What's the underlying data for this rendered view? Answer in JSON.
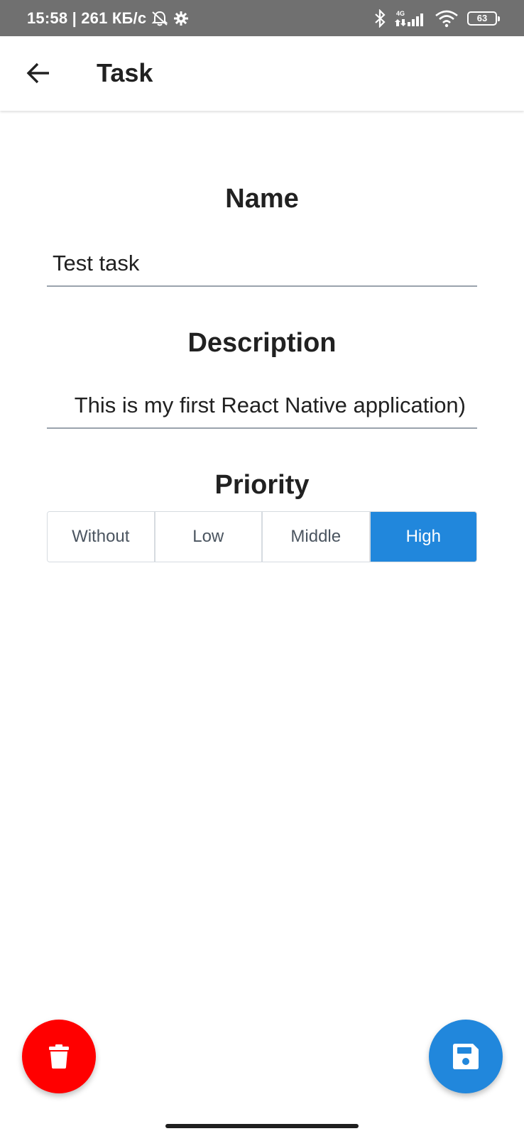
{
  "status_bar": {
    "time_and_speed": "15:58 | 261 КБ/с",
    "network_label": "4G",
    "battery_level": "63",
    "icons": [
      "silent-alarm-icon",
      "gear-icon",
      "bluetooth-icon",
      "signal-icon",
      "wifi-icon",
      "battery-icon"
    ]
  },
  "header": {
    "title": "Task",
    "back_icon": "arrow-left-icon"
  },
  "form": {
    "name": {
      "label": "Name",
      "value": "Test task"
    },
    "description": {
      "label": "Description",
      "value": "This is my first React Native application)"
    },
    "priority": {
      "label": "Priority",
      "options": [
        "Without",
        "Low",
        "Middle",
        "High"
      ],
      "selected": "High"
    }
  },
  "actions": {
    "delete_icon": "trash-icon",
    "save_icon": "floppy-disk-icon"
  },
  "colors": {
    "accent": "#2187dc",
    "danger": "#ff0000",
    "status_bar": "#707070"
  }
}
